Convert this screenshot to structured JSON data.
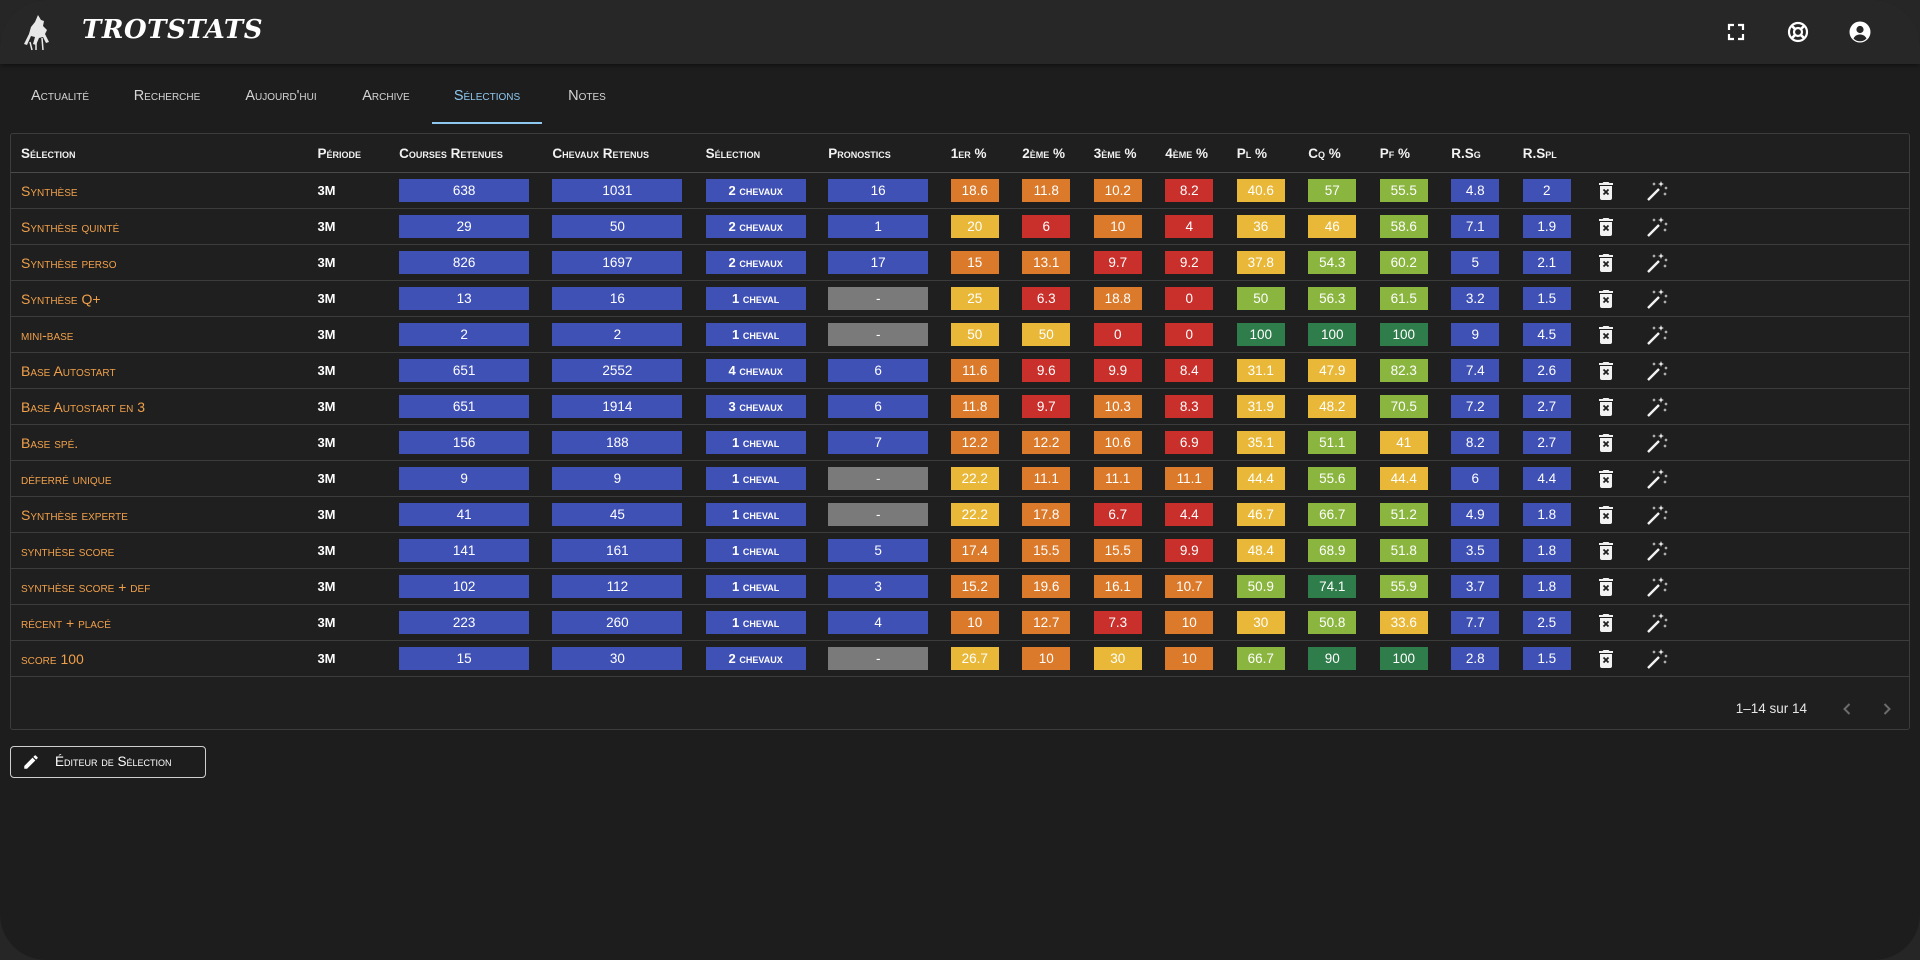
{
  "app": {
    "brand": "TROTSTATS"
  },
  "top_icons": [
    "fullscreen-icon",
    "lifebuoy-icon",
    "account-circle-icon"
  ],
  "tabs": [
    {
      "label": "Actualité",
      "active": false
    },
    {
      "label": "Recherche",
      "active": false
    },
    {
      "label": "Aujourd'hui",
      "active": false
    },
    {
      "label": "Archive",
      "active": false
    },
    {
      "label": "Sélections",
      "active": true
    },
    {
      "label": "Notes",
      "active": false
    }
  ],
  "columns": [
    "Sélection",
    "Période",
    "Courses Retenues",
    "Chevaux Retenus",
    "Sélection",
    "Pronostics",
    "1er %",
    "2ème %",
    "3ème %",
    "4ème %",
    "Pl %",
    "Cq %",
    "Pf %",
    "R.Sg",
    "R.Spl"
  ],
  "rows": [
    {
      "name": "Synthèse",
      "periode": "3M",
      "courses": "638",
      "chevaux": "1031",
      "selection": "2 chevaux",
      "pronostics": "16",
      "p1": "18.6",
      "p2": "11.8",
      "p3": "10.2",
      "p4": "8.2",
      "pl": "40.6",
      "cq": "57",
      "pf": "55.5",
      "rsg": "4.8",
      "rspl": "2"
    },
    {
      "name": "Synthèse quinté",
      "periode": "3M",
      "courses": "29",
      "chevaux": "50",
      "selection": "2 chevaux",
      "pronostics": "1",
      "p1": "20",
      "p2": "6",
      "p3": "10",
      "p4": "4",
      "pl": "36",
      "cq": "46",
      "pf": "58.6",
      "rsg": "7.1",
      "rspl": "1.9"
    },
    {
      "name": "Synthèse perso",
      "periode": "3M",
      "courses": "826",
      "chevaux": "1697",
      "selection": "2 chevaux",
      "pronostics": "17",
      "p1": "15",
      "p2": "13.1",
      "p3": "9.7",
      "p4": "9.2",
      "pl": "37.8",
      "cq": "54.3",
      "pf": "60.2",
      "rsg": "5",
      "rspl": "2.1"
    },
    {
      "name": "Synthèse Q+",
      "periode": "3M",
      "courses": "13",
      "chevaux": "16",
      "selection": "1 cheval",
      "pronostics": "-",
      "p1": "25",
      "p2": "6.3",
      "p3": "18.8",
      "p4": "0",
      "pl": "50",
      "cq": "56.3",
      "pf": "61.5",
      "rsg": "3.2",
      "rspl": "1.5"
    },
    {
      "name": "mini-base",
      "periode": "3M",
      "courses": "2",
      "chevaux": "2",
      "selection": "1 cheval",
      "pronostics": "-",
      "p1": "50",
      "p2": "50",
      "p3": "0",
      "p4": "0",
      "pl": "100",
      "cq": "100",
      "pf": "100",
      "rsg": "9",
      "rspl": "4.5"
    },
    {
      "name": "Base Autostart",
      "periode": "3M",
      "courses": "651",
      "chevaux": "2552",
      "selection": "4 chevaux",
      "pronostics": "6",
      "p1": "11.6",
      "p2": "9.6",
      "p3": "9.9",
      "p4": "8.4",
      "pl": "31.1",
      "cq": "47.9",
      "pf": "82.3",
      "rsg": "7.4",
      "rspl": "2.6"
    },
    {
      "name": "Base Autostart en 3",
      "periode": "3M",
      "courses": "651",
      "chevaux": "1914",
      "selection": "3 chevaux",
      "pronostics": "6",
      "p1": "11.8",
      "p2": "9.7",
      "p3": "10.3",
      "p4": "8.3",
      "pl": "31.9",
      "cq": "48.2",
      "pf": "70.5",
      "rsg": "7.2",
      "rspl": "2.7"
    },
    {
      "name": "Base spé.",
      "periode": "3M",
      "courses": "156",
      "chevaux": "188",
      "selection": "1 cheval",
      "pronostics": "7",
      "p1": "12.2",
      "p2": "12.2",
      "p3": "10.6",
      "p4": "6.9",
      "pl": "35.1",
      "cq": "51.1",
      "pf": "41",
      "rsg": "8.2",
      "rspl": "2.7"
    },
    {
      "name": "déferré unique",
      "periode": "3M",
      "courses": "9",
      "chevaux": "9",
      "selection": "1 cheval",
      "pronostics": "-",
      "p1": "22.2",
      "p2": "11.1",
      "p3": "11.1",
      "p4": "11.1",
      "pl": "44.4",
      "cq": "55.6",
      "pf": "44.4",
      "rsg": "6",
      "rspl": "4.4"
    },
    {
      "name": "Synthèse experte",
      "periode": "3M",
      "courses": "41",
      "chevaux": "45",
      "selection": "1 cheval",
      "pronostics": "-",
      "p1": "22.2",
      "p2": "17.8",
      "p3": "6.7",
      "p4": "4.4",
      "pl": "46.7",
      "cq": "66.7",
      "pf": "51.2",
      "rsg": "4.9",
      "rspl": "1.8"
    },
    {
      "name": "synthèse score",
      "periode": "3M",
      "courses": "141",
      "chevaux": "161",
      "selection": "1 cheval",
      "pronostics": "5",
      "p1": "17.4",
      "p2": "15.5",
      "p3": "15.5",
      "p4": "9.9",
      "pl": "48.4",
      "cq": "68.9",
      "pf": "51.8",
      "rsg": "3.5",
      "rspl": "1.8"
    },
    {
      "name": "synthèse score + def",
      "periode": "3M",
      "courses": "102",
      "chevaux": "112",
      "selection": "1 cheval",
      "pronostics": "3",
      "p1": "15.2",
      "p2": "19.6",
      "p3": "16.1",
      "p4": "10.7",
      "pl": "50.9",
      "cq": "74.1",
      "pf": "55.9",
      "rsg": "3.7",
      "rspl": "1.8"
    },
    {
      "name": "récent + placé",
      "periode": "3M",
      "courses": "223",
      "chevaux": "260",
      "selection": "1 cheval",
      "pronostics": "4",
      "p1": "10",
      "p2": "12.7",
      "p3": "7.3",
      "p4": "10",
      "pl": "30",
      "cq": "50.8",
      "pf": "33.6",
      "rsg": "7.7",
      "rspl": "2.5"
    },
    {
      "name": "score 100",
      "periode": "3M",
      "courses": "15",
      "chevaux": "30",
      "selection": "2 chevaux",
      "pronostics": "-",
      "p1": "26.7",
      "p2": "10",
      "p3": "30",
      "p4": "10",
      "pl": "66.7",
      "cq": "90",
      "pf": "100",
      "rsg": "2.8",
      "rspl": "1.5"
    }
  ],
  "row_actions": [
    "delete-icon",
    "magic-wand-icon"
  ],
  "pagination": {
    "text": "1–14 sur 14"
  },
  "editor_button": {
    "label": "Éditeur de Sélection"
  },
  "colors": {
    "blue": "#3f51b5",
    "grey": "#7a7a7a",
    "red": "#c9302c",
    "orange": "#db7a2b",
    "yellow": "#e9b838",
    "lightgreen": "#8ab53f",
    "darkgreen": "#2e7d4a",
    "name_text": "#f0a04a",
    "active_tab": "#8ec8ef"
  }
}
